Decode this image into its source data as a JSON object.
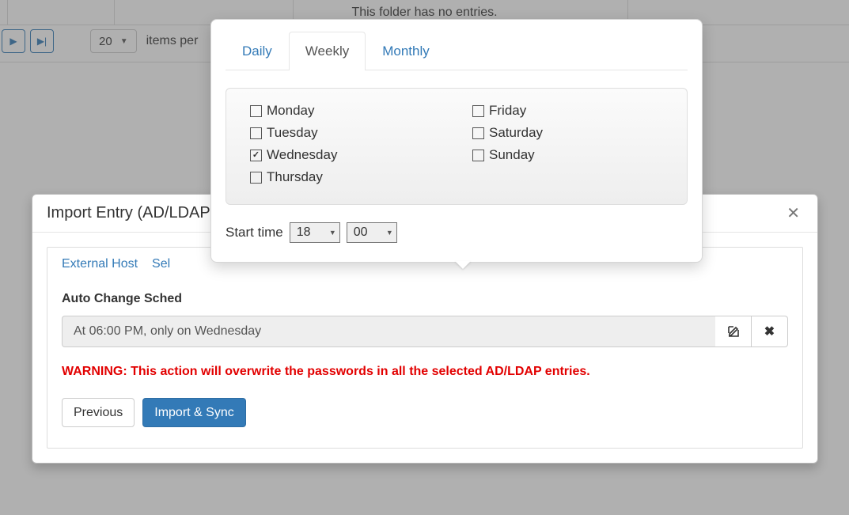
{
  "background": {
    "empty_msg": "This folder has no entries.",
    "pager": {
      "page_size": "20",
      "label": "items per"
    }
  },
  "modal": {
    "title": "Import Entry (AD/LDAP)",
    "tabs": {
      "t1": "External Host",
      "t2": "Sel"
    },
    "section_title": "Auto Change Sched",
    "schedule_text": "At 06:00 PM, only on Wednesday",
    "warning": "WARNING: This action will overwrite the passwords in all the selected AD/LDAP entries.",
    "buttons": {
      "prev": "Previous",
      "import": "Import & Sync"
    }
  },
  "popover": {
    "tabs": {
      "daily": "Daily",
      "weekly": "Weekly",
      "monthly": "Monthly"
    },
    "days": {
      "monday": {
        "label": "Monday",
        "checked": false
      },
      "tuesday": {
        "label": "Tuesday",
        "checked": false
      },
      "wednesday": {
        "label": "Wednesday",
        "checked": true
      },
      "thursday": {
        "label": "Thursday",
        "checked": false
      },
      "friday": {
        "label": "Friday",
        "checked": false
      },
      "saturday": {
        "label": "Saturday",
        "checked": false
      },
      "sunday": {
        "label": "Sunday",
        "checked": false
      }
    },
    "start_label": "Start time",
    "hour": "18",
    "minute": "00"
  }
}
